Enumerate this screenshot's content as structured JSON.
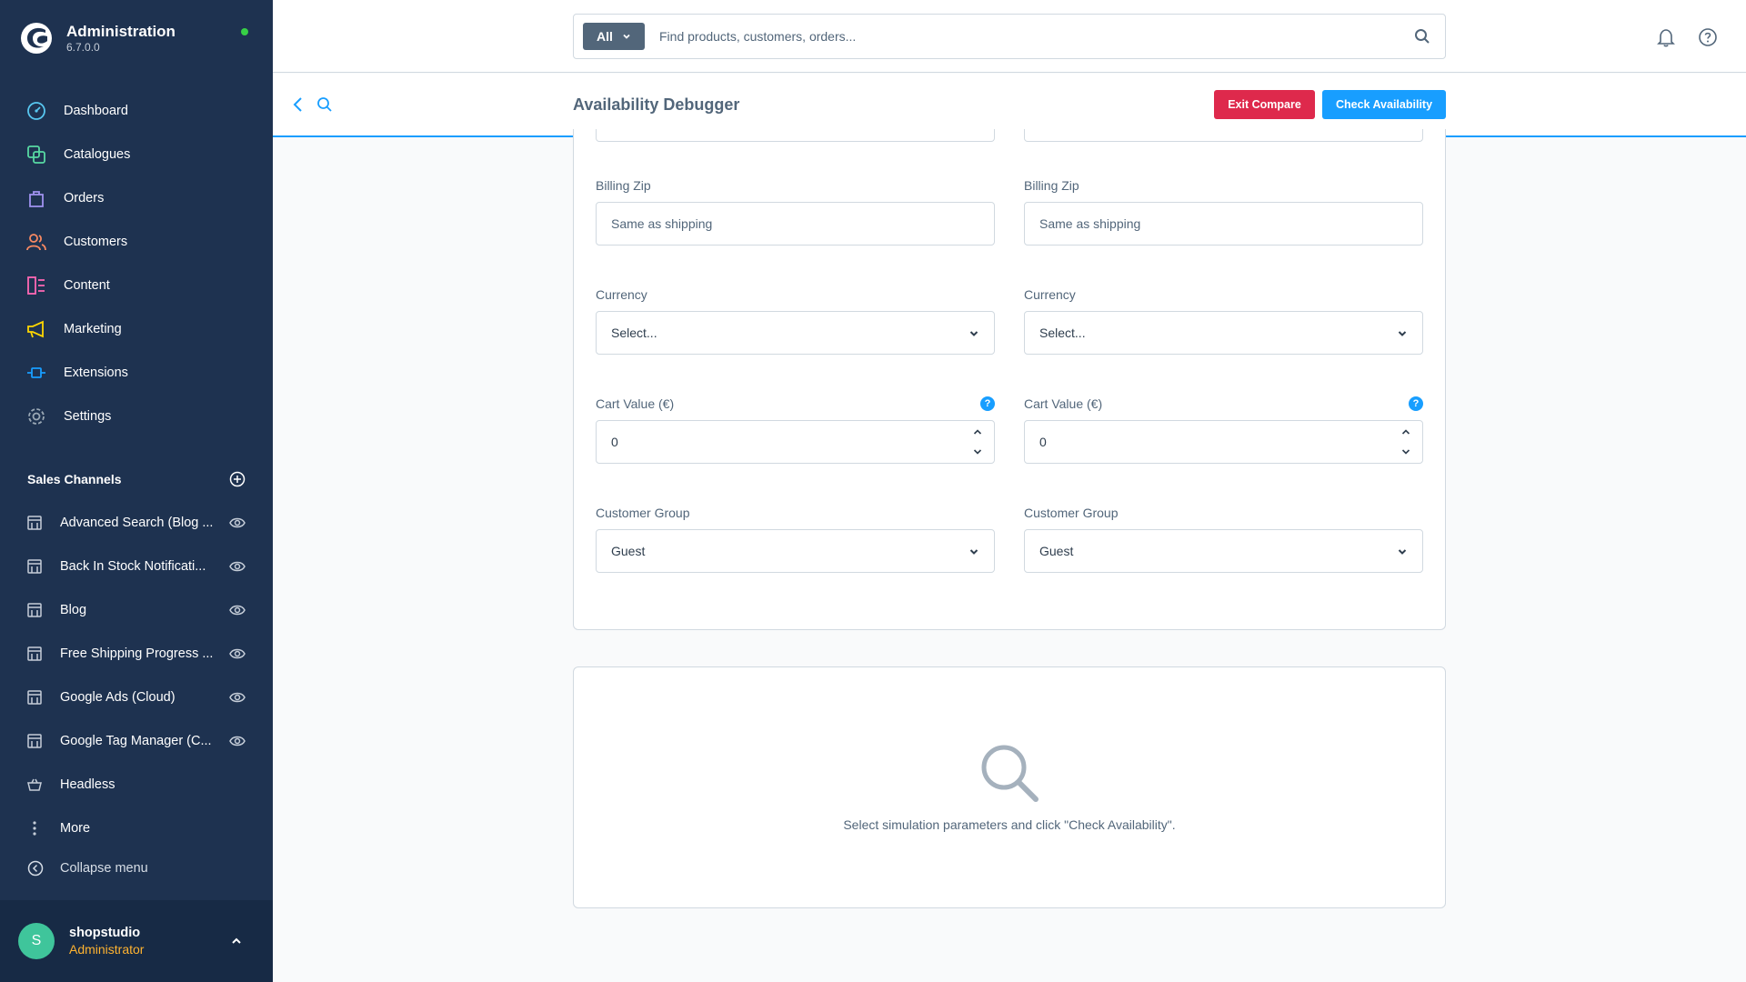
{
  "brand": {
    "title": "Administration",
    "version": "6.7.0.0"
  },
  "nav": [
    {
      "id": "dashboard",
      "label": "Dashboard",
      "color": "#58c7f0"
    },
    {
      "id": "catalogues",
      "label": "Catalogues",
      "color": "#57d9a3"
    },
    {
      "id": "orders",
      "label": "Orders",
      "color": "#a092f0"
    },
    {
      "id": "customers",
      "label": "Customers",
      "color": "#f88962"
    },
    {
      "id": "content",
      "label": "Content",
      "color": "#ff68b4"
    },
    {
      "id": "marketing",
      "label": "Marketing",
      "color": "#ffd700"
    },
    {
      "id": "extensions",
      "label": "Extensions",
      "color": "#189eff"
    },
    {
      "id": "settings",
      "label": "Settings",
      "color": "#9aa8b5"
    }
  ],
  "sales_channels": {
    "title": "Sales Channels",
    "items": [
      {
        "label": "Advanced Search (Blog ..."
      },
      {
        "label": "Back In Stock Notificati..."
      },
      {
        "label": "Blog"
      },
      {
        "label": "Free Shipping Progress ..."
      },
      {
        "label": "Google Ads (Cloud)"
      },
      {
        "label": "Google Tag Manager (C..."
      },
      {
        "label": "Headless"
      }
    ],
    "more_label": "More",
    "collapse_label": "Collapse menu"
  },
  "user": {
    "initial": "S",
    "name": "shopstudio",
    "role": "Administrator"
  },
  "search": {
    "scope": "All",
    "placeholder": "Find products, customers, orders..."
  },
  "page": {
    "title": "Availability Debugger",
    "exit_compare": "Exit Compare",
    "check_availability": "Check Availability"
  },
  "form": {
    "left": {
      "billing_zip": {
        "label": "Billing Zip",
        "placeholder": "Same as shipping"
      },
      "currency": {
        "label": "Currency",
        "value": "Select..."
      },
      "cart_value": {
        "label": "Cart Value (€)",
        "value": "0",
        "hint": "?"
      },
      "customer_group": {
        "label": "Customer Group",
        "value": "Guest"
      }
    },
    "right": {
      "billing_zip": {
        "label": "Billing Zip",
        "placeholder": "Same as shipping"
      },
      "currency": {
        "label": "Currency",
        "value": "Select..."
      },
      "cart_value": {
        "label": "Cart Value (€)",
        "value": "0",
        "hint": "?"
      },
      "customer_group": {
        "label": "Customer Group",
        "value": "Guest"
      }
    }
  },
  "empty_state": {
    "message": "Select simulation parameters and click \"Check Availability\"."
  }
}
